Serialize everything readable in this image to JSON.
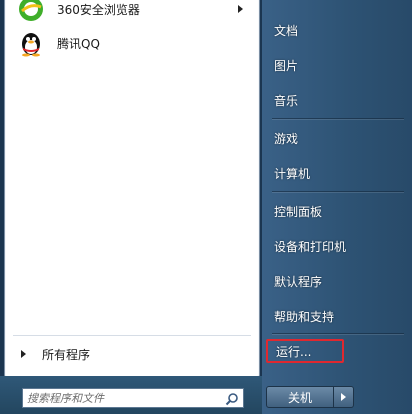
{
  "pinned": {
    "browser_label": "360安全浏览器",
    "qq_label": "腾讯QQ"
  },
  "all_programs_label": "所有程序",
  "search": {
    "placeholder": "搜索程序和文件"
  },
  "right_menu": {
    "documents": "文档",
    "pictures": "图片",
    "music": "音乐",
    "games": "游戏",
    "computer": "计算机",
    "control_panel": "控制面板",
    "devices_printers": "设备和打印机",
    "default_programs": "默认程序",
    "help_support": "帮助和支持",
    "run": "运行..."
  },
  "shutdown_label": "关机",
  "colors": {
    "highlight_border": "#e0282f",
    "right_pane": "#2d5273"
  }
}
